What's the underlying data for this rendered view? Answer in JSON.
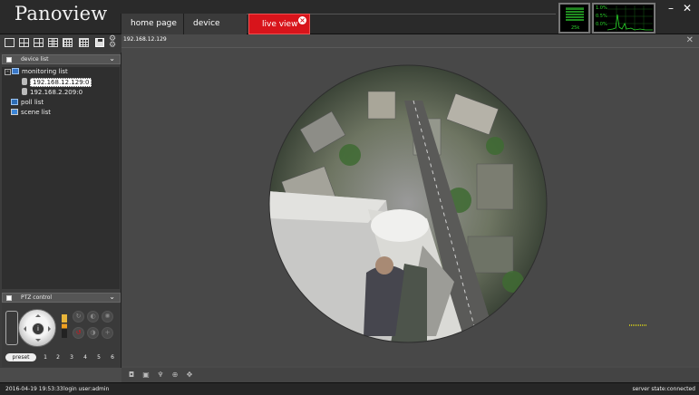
{
  "app": {
    "title": "Panoview"
  },
  "tabs": [
    {
      "label": "home page"
    },
    {
      "label": "device manag..."
    },
    {
      "label": "live view",
      "active": true,
      "accent": "#d8141b"
    }
  ],
  "monitors": {
    "net_value": "25k",
    "cpu_labels": [
      "1.0%",
      "0.5%",
      "0.0%"
    ]
  },
  "window_controls": {
    "minimize": "–",
    "close": "✕"
  },
  "device_panel": {
    "header": "device list",
    "tree": {
      "root": "monitoring list",
      "devices": [
        "192.168.12.129:0",
        "192.168.2.209:0"
      ],
      "selected_device": "192.168.12.129:0",
      "other_items": [
        "poll list",
        "scene list"
      ]
    }
  },
  "ptz": {
    "header": "PTZ control",
    "preset_label": "preset",
    "preset_numbers": [
      "1",
      "2",
      "3",
      "4",
      "5",
      "6"
    ],
    "center_icon": "i"
  },
  "video": {
    "title": "192.168.12.129",
    "close_label": "✕",
    "tools": [
      "snapshot-icon",
      "fullscreen-icon",
      "microphone-icon",
      "zoom-icon",
      "ptz-move-icon"
    ]
  },
  "status": {
    "time": "2016-04-19 19:53:33",
    "user": "login user:admin",
    "server": "server state:connected"
  },
  "colors": {
    "accent": "#d8141b",
    "monitor_green": "#2bd62b"
  }
}
